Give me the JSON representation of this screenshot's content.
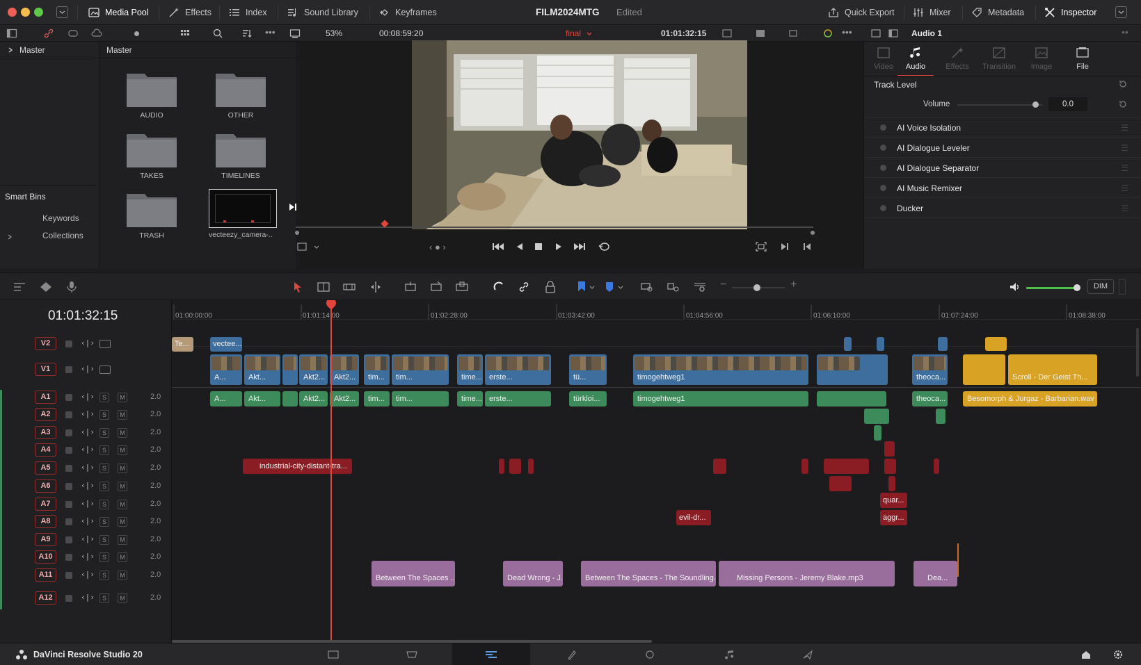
{
  "app": {
    "name": "DaVinci Resolve Studio 20",
    "project": "FILM2024MTG",
    "project_state": "Edited"
  },
  "topbar": {
    "left": [
      "Media Pool",
      "Effects",
      "Index",
      "Sound Library",
      "Keyframes"
    ],
    "right": [
      "Quick Export",
      "Mixer",
      "Metadata",
      "Inspector"
    ]
  },
  "toolbar2": {
    "zoom": "53%",
    "duration": "00:08:59:20",
    "timeline_name": "final",
    "timecode": "01:01:32:15",
    "inspector_title": "Audio 1"
  },
  "bins": {
    "header": "Master",
    "smart_bins_title": "Smart Bins",
    "smart_items": [
      "Keywords",
      "Collections"
    ]
  },
  "pool": {
    "header": "Master",
    "items": [
      {
        "label": "AUDIO",
        "kind": "folder"
      },
      {
        "label": "OTHER",
        "kind": "folder"
      },
      {
        "label": "TAKES",
        "kind": "folder"
      },
      {
        "label": "TIMELINES",
        "kind": "folder"
      },
      {
        "label": "TRASH",
        "kind": "folder"
      },
      {
        "label": "vecteezy_camera-...",
        "kind": "clip"
      }
    ]
  },
  "inspector": {
    "tabs": [
      {
        "label": "Video",
        "active": false
      },
      {
        "label": "Audio",
        "active": true
      },
      {
        "label": "Effects",
        "active": false
      },
      {
        "label": "Transition",
        "active": false
      },
      {
        "label": "Image",
        "active": false
      },
      {
        "label": "File",
        "active": false
      }
    ],
    "section_title": "Track Level",
    "volume_label": "Volume",
    "volume_value": "0.0",
    "effects": [
      "AI Voice Isolation",
      "AI Dialogue Leveler",
      "AI Dialogue Separator",
      "AI Music Remixer",
      "Ducker"
    ]
  },
  "timeline": {
    "timecode": "01:01:32:15",
    "ruler": [
      "01:00:00:00",
      "01:01:14:00",
      "01:02:28:00",
      "01:03:42:00",
      "01:04:56:00",
      "01:06:10:00",
      "01:07:24:00",
      "01:08:38:00"
    ],
    "dim_label": "DIM",
    "tracks": [
      {
        "name": "V2",
        "kind": "video"
      },
      {
        "name": "V1",
        "kind": "video"
      },
      {
        "name": "A1",
        "kind": "audio",
        "vol": "2.0"
      },
      {
        "name": "A2",
        "kind": "audio",
        "vol": "2.0"
      },
      {
        "name": "A3",
        "kind": "audio",
        "vol": "2.0"
      },
      {
        "name": "A4",
        "kind": "audio",
        "vol": "2.0"
      },
      {
        "name": "A5",
        "kind": "audio",
        "vol": "2.0"
      },
      {
        "name": "A6",
        "kind": "audio",
        "vol": "2.0"
      },
      {
        "name": "A7",
        "kind": "audio",
        "vol": "2.0"
      },
      {
        "name": "A8",
        "kind": "audio",
        "vol": "2.0"
      },
      {
        "name": "A9",
        "kind": "audio",
        "vol": "2.0"
      },
      {
        "name": "A10",
        "kind": "audio",
        "vol": "2.0"
      },
      {
        "name": "A11",
        "kind": "audio",
        "vol": "2.0"
      },
      {
        "name": "A12",
        "kind": "audio",
        "vol": "2.0"
      }
    ],
    "solo_label": "S",
    "mute_label": "M",
    "clips": {
      "v2": [
        "Te...",
        "vectee..."
      ],
      "v1": [
        "A...",
        "Akt...",
        "Akt2...",
        "Akt2...",
        "tim...",
        "tim...",
        "time...",
        "erste...",
        "tü...",
        "timogehtweg1",
        "theoca...",
        "Scroll - Der Geist Th..."
      ],
      "a1": [
        "A...",
        "Akt...",
        "Akt2...",
        "Akt2...",
        "tim...",
        "tim...",
        "time...",
        "erste...",
        "türkloi...",
        "timogehtweg1",
        "theoca...",
        "Besomorph & Jurgaz - Barbarian.wav"
      ],
      "a6": "industrial-city-distant-tra...",
      "a8": "quar...",
      "a9": [
        "evil-dr...",
        "aggr..."
      ],
      "a12": [
        "Between The Spaces ...",
        "Dead Wrong - J...",
        "Between The Spaces - The Soundling...",
        "Missing Persons - Jeremy Blake.mp3",
        "Dea..."
      ]
    }
  },
  "colors": {
    "accent": "#e0463c",
    "video_clip": "#3e6e9e",
    "audio_clip": "#3d8a5a",
    "music_clip": "#9a6e9c",
    "sfx_clip": "#8a1c24",
    "gold_clip": "#d8a225"
  }
}
